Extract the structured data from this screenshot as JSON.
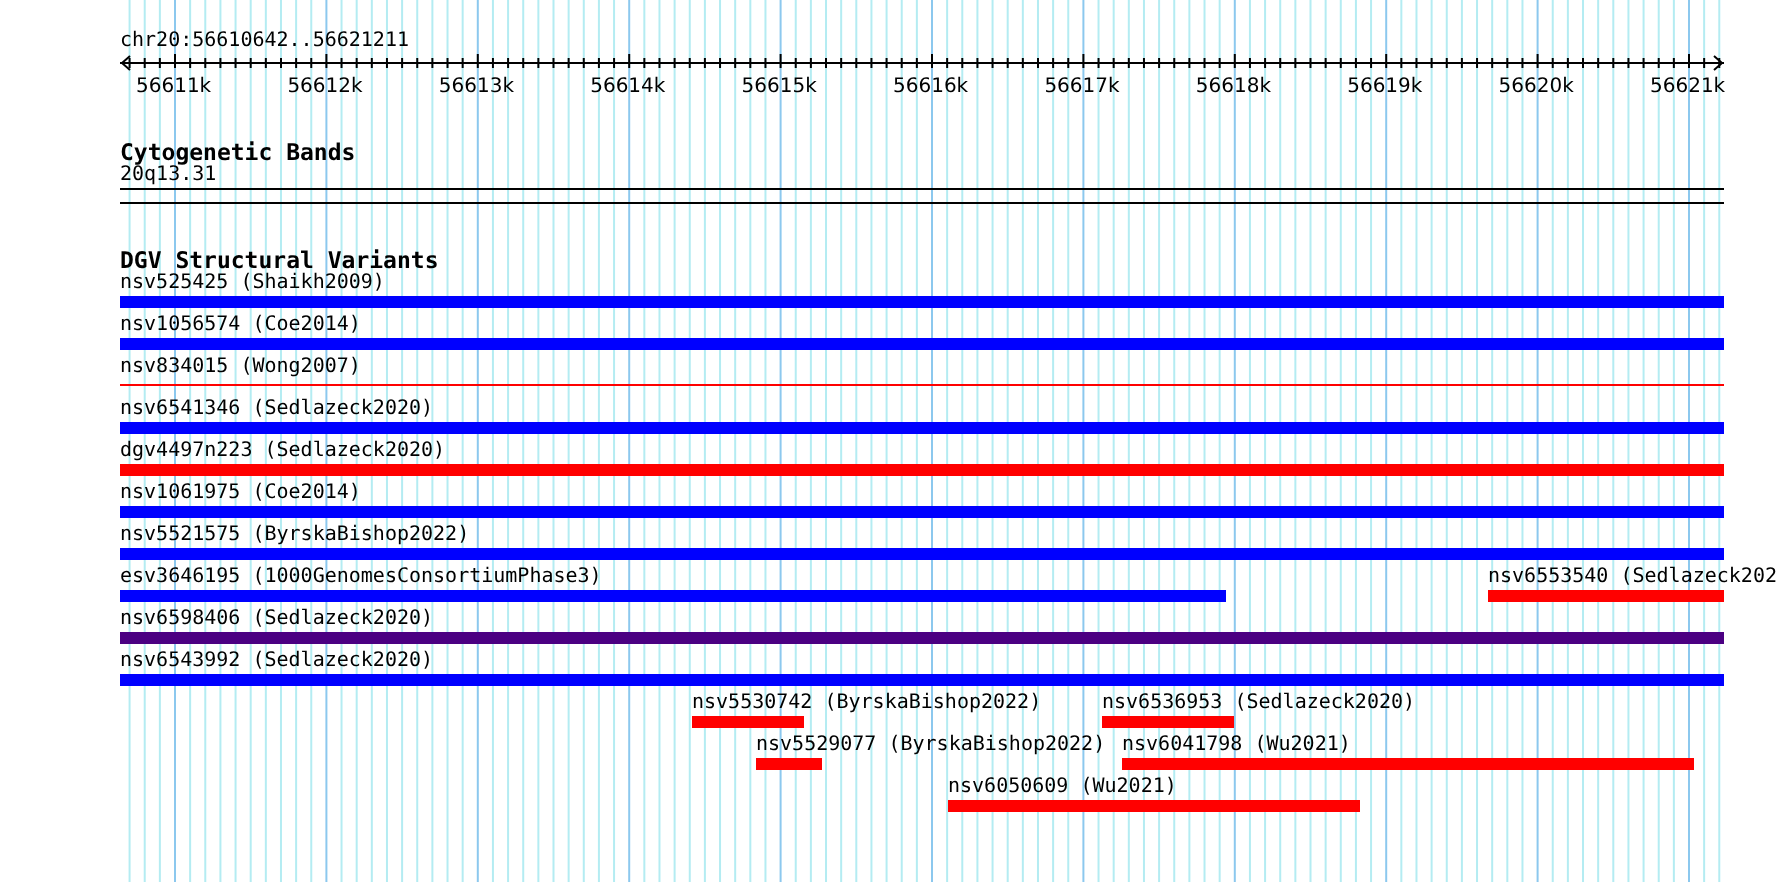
{
  "location": "chr20:56610642..56621211",
  "ruler": {
    "ticks": [
      "56611k",
      "56612k",
      "56613k",
      "56614k",
      "56615k",
      "56616k",
      "56617k",
      "56618k",
      "56619k",
      "56620k",
      "56621k"
    ]
  },
  "cytoband_track": {
    "title": "Cytogenetic Bands",
    "band": "20q13.31"
  },
  "variant_track": {
    "title": "DGV Structural Variants",
    "rows": [
      [
        {
          "label": "nsv525425 (Shaikh2009)",
          "color": "#0000ff",
          "kind": "bar"
        }
      ],
      [
        {
          "label": "nsv1056574 (Coe2014)",
          "color": "#0000ff",
          "kind": "bar"
        }
      ],
      [
        {
          "label": "nsv834015 (Wong2007)",
          "color": "#ff0000",
          "kind": "line"
        }
      ],
      [
        {
          "label": "nsv6541346 (Sedlazeck2020)",
          "color": "#0000ff",
          "kind": "bar"
        }
      ],
      [
        {
          "label": "dgv4497n223 (Sedlazeck2020)",
          "color": "#ff0000",
          "kind": "bar"
        }
      ],
      [
        {
          "label": "nsv1061975 (Coe2014)",
          "color": "#0000ff",
          "kind": "bar"
        }
      ],
      [
        {
          "label": "nsv5521575 (ByrskaBishop2022)",
          "color": "#0000ff",
          "kind": "bar"
        }
      ],
      [
        {
          "label": "esv3646195 (1000GenomesConsortiumPhase3)",
          "color": "#0000ff",
          "kind": "bar"
        },
        {
          "label": "nsv6553540 (Sedlazeck202",
          "color": "#ff0000",
          "kind": "bar"
        }
      ],
      [
        {
          "label": "nsv6598406 (Sedlazeck2020)",
          "color": "#4b0082",
          "kind": "bar"
        }
      ],
      [
        {
          "label": "nsv6543992 (Sedlazeck2020)",
          "color": "#0000ff",
          "kind": "bar"
        }
      ],
      [
        {
          "label": "nsv5530742 (ByrskaBishop2022)",
          "color": "#ff0000",
          "kind": "bar"
        },
        {
          "label": "nsv6536953 (Sedlazeck2020)",
          "color": "#ff0000",
          "kind": "bar"
        }
      ],
      [
        {
          "label": "nsv5529077 (ByrskaBishop2022)",
          "color": "#ff0000",
          "kind": "bar"
        },
        {
          "label": "nsv6041798 (Wu2021)",
          "color": "#ff0000",
          "kind": "bar"
        }
      ],
      [
        {
          "label": "nsv6050609 (Wu2021)",
          "color": "#ff0000",
          "kind": "bar"
        }
      ]
    ]
  }
}
